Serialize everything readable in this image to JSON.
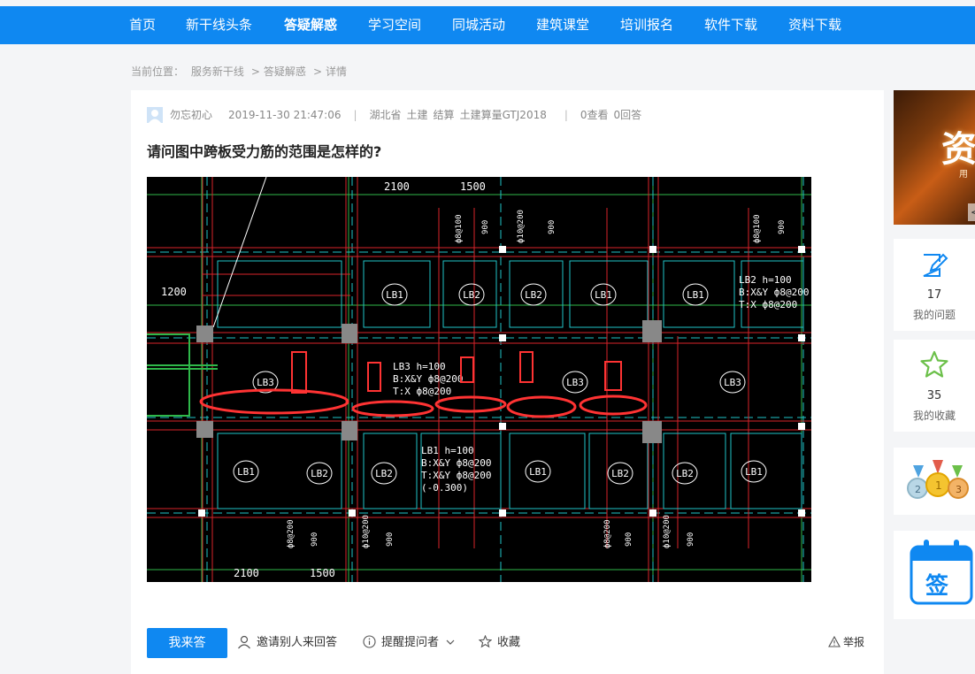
{
  "nav": {
    "items": [
      {
        "label": "首页"
      },
      {
        "label": "新干线头条"
      },
      {
        "label": "答疑解惑",
        "active": true
      },
      {
        "label": "学习空间"
      },
      {
        "label": "同城活动"
      },
      {
        "label": "建筑课堂"
      },
      {
        "label": "培训报名"
      },
      {
        "label": "软件下载"
      },
      {
        "label": "资料下载"
      }
    ]
  },
  "breadcrumb": {
    "prefix": "当前位置：",
    "items": [
      "服务新干线",
      "答疑解惑",
      "详情"
    ],
    "separator": ">"
  },
  "question": {
    "author": "勿忘初心",
    "datetime": "2019-11-30 21:47:06",
    "region": "湖北省",
    "tags": [
      "土建",
      "结算",
      "土建算量GTJ2018"
    ],
    "views": "0查看",
    "answers": "0回答",
    "title": "请问图中跨板受力筋的范围是怎样的?"
  },
  "drawing": {
    "dims_top": [
      "2100",
      "1500"
    ],
    "dims_bottom": [
      "2100",
      "1500"
    ],
    "dim_left": "1200",
    "slab_labels": [
      "LB1",
      "LB2",
      "LB3"
    ],
    "note_lb2": [
      "LB2 h=100",
      "B:X&Y ф8@200",
      "T:X ф8@200"
    ],
    "note_lb3": [
      "LB3 h=100",
      "B:X&Y ф8@200",
      "T:X ф8@200"
    ],
    "note_lb1": [
      "LB1 h=100",
      "B:X&Y ф8@200",
      "T:X&Y ф8@200",
      "(-0.300)"
    ],
    "rebar_labels": [
      "ф8@100",
      "ф10@200",
      "ф8@100",
      "ф8@200",
      "ф10@200",
      "ф8@200",
      "ф10@200",
      "ф8@200"
    ],
    "len_labels": [
      "900"
    ]
  },
  "actions": {
    "answer_btn": "我来答",
    "invite": "邀请别人来回答",
    "remind": "提醒提问者",
    "collect": "收藏",
    "report": "举报"
  },
  "sidebar": {
    "banner_text": "资",
    "banner_sub": "用",
    "banner_arrow": "<",
    "my_questions_count": "17",
    "my_questions_label": "我的问题",
    "my_favs_count": "35",
    "my_favs_label": "我的收藏",
    "sign_label": "签"
  },
  "colors": {
    "brand": "#0f88f1",
    "cad_bg": "#000000",
    "highlight": "#ff3333"
  }
}
